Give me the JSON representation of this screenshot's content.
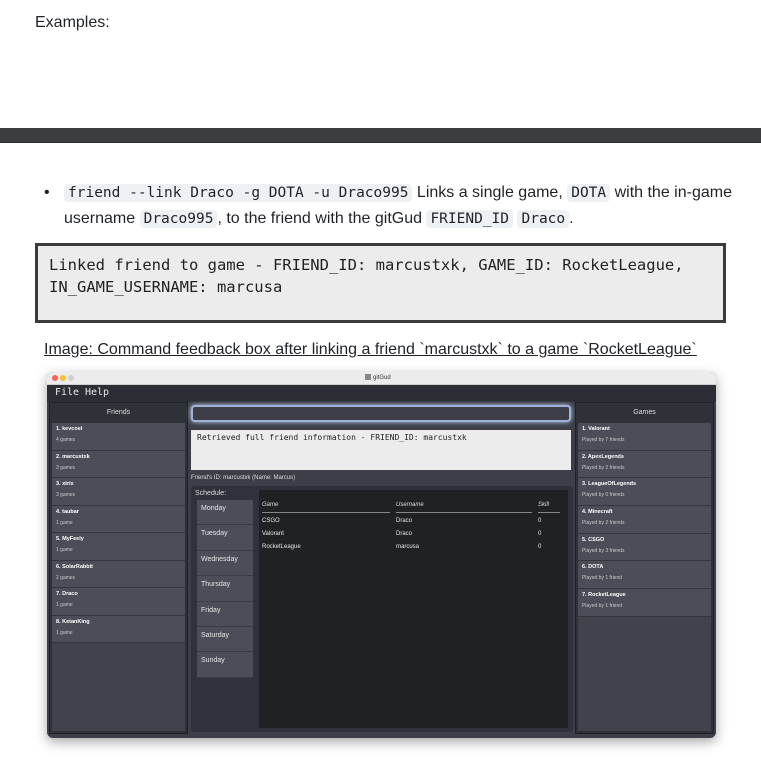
{
  "doc": {
    "examples_label": "Examples:",
    "bullet": {
      "code1": "friend --link Draco -g DOTA -u Draco995",
      "text1": " Links a single game, ",
      "code2": "DOTA",
      "text2": " with the in-game username ",
      "code3": "Draco995",
      "text3": ", to the friend with the gitGud ",
      "code4": "FRIEND_ID",
      "text4": " ",
      "code5": "Draco",
      "text5": "."
    },
    "codebox": {
      "line1": "Linked friend to game - FRIEND_ID: marcustxk, GAME_ID: RocketLeague,",
      "line2": "IN_GAME_USERNAME: marcusa"
    },
    "caption": "Image: Command feedback box after linking a friend `marcustxk` to a game `RocketLeague`"
  },
  "app": {
    "window_title": "gitGud",
    "menu": [
      "File",
      "Help"
    ],
    "friends_header": "Friends",
    "games_header": "Games",
    "friends": [
      {
        "name": "1. kevcoel",
        "sub": "4 games"
      },
      {
        "name": "2. marcustxk",
        "sub": "3 games"
      },
      {
        "name": "3. xtrix",
        "sub": "3 games"
      },
      {
        "name": "4. taubar",
        "sub": "1 game"
      },
      {
        "name": "5. MyFeely",
        "sub": "1 game"
      },
      {
        "name": "6. SolarRabbit",
        "sub": "2 games"
      },
      {
        "name": "7. Draco",
        "sub": "1 game"
      },
      {
        "name": "8. KetanKing",
        "sub": "1 game"
      }
    ],
    "command_value": "",
    "result_text": "Retrieved full friend information - FRIEND_ID: marcustxk",
    "friend_id_label": "Friend's ID: marcustxk (Name: Marcus)",
    "schedule_label": "Schedule:",
    "days": [
      "Monday",
      "Tuesday",
      "Wednesday",
      "Thursday",
      "Friday",
      "Saturday",
      "Sunday"
    ],
    "table": {
      "headers": [
        "Game",
        "Username",
        "Skill"
      ],
      "rows": [
        [
          "CSGO",
          "Draco",
          "0"
        ],
        [
          "Valorant",
          "Draco",
          "0"
        ],
        [
          "RocketLeague",
          "marcusa",
          "0"
        ]
      ]
    },
    "games": [
      {
        "name": "1. Valorant",
        "sub": "Played by 7 friends"
      },
      {
        "name": "2. ApexLegends",
        "sub": "Played by 2 friends"
      },
      {
        "name": "3. LeagueOfLegends",
        "sub": "Played by 0 friends"
      },
      {
        "name": "4. Minecraft",
        "sub": "Played by 2 friends"
      },
      {
        "name": "5. CSGO",
        "sub": "Played by 3 friends"
      },
      {
        "name": "6. DOTA",
        "sub": "Played by 1 friend"
      },
      {
        "name": "7. RocketLeague",
        "sub": "Played by 1 friend"
      }
    ],
    "colors": {
      "window_bg": "#3c3f48",
      "list_item": "#4b4e58",
      "table_bg": "#1f2125",
      "focus_ring": "#9fb2d9",
      "traffic_red": "#ff5f57",
      "traffic_yellow": "#febc2e",
      "traffic_gray": "#d0d0d0"
    }
  }
}
